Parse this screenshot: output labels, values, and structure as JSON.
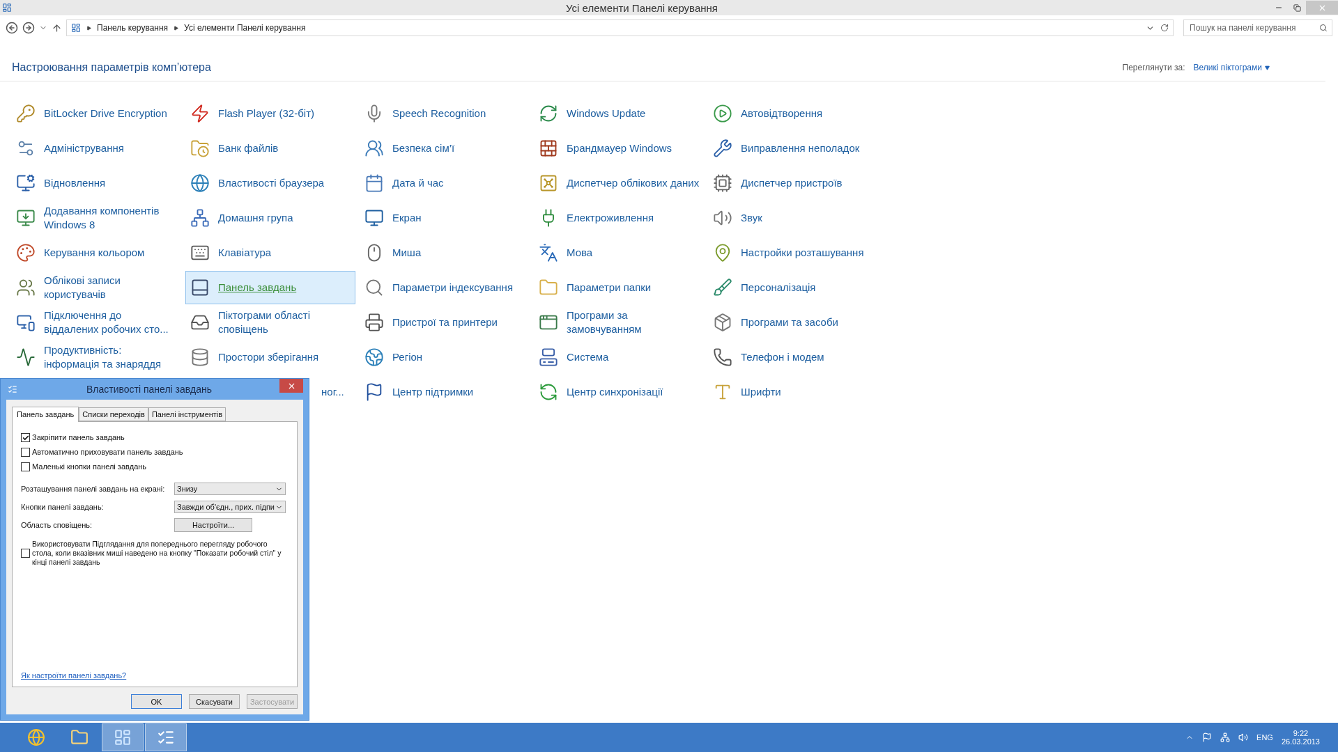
{
  "window": {
    "title": "Усі елементи Панелі керування"
  },
  "address_bar": {
    "breadcrumbs": [
      "Панель керування",
      "Усі елементи Панелі керування"
    ],
    "search": {
      "placeholder": "Пошук на панелі керування"
    }
  },
  "header": {
    "title": "Настроювання параметрів комп’ютера",
    "view_label": "Переглянути за:",
    "view_value": "Великі піктограми"
  },
  "columns": [
    {
      "items": [
        {
          "label": "BitLocker Drive Encryption",
          "selected": false
        },
        {
          "label": "Адміністрування",
          "selected": false
        },
        {
          "label": "Відновлення",
          "selected": false
        },
        {
          "label": "Додавання компонентів Windows 8",
          "selected": false
        },
        {
          "label": "Керування кольором",
          "selected": false
        },
        {
          "label": "Облікові записи користувачів",
          "selected": false
        },
        {
          "label": "Підключення до віддалених робочих сто...",
          "selected": false
        },
        {
          "label": "Продуктивність: інформація та знаряддя",
          "selected": false
        }
      ]
    },
    {
      "items": [
        {
          "label": "Flash Player (32-біт)",
          "selected": false
        },
        {
          "label": "Банк файлів",
          "selected": false
        },
        {
          "label": "Властивості браузера",
          "selected": false
        },
        {
          "label": "Домашня група",
          "selected": false
        },
        {
          "label": "Клавіатура",
          "selected": false
        },
        {
          "label": "Панель завдань",
          "selected": true
        },
        {
          "label": "Піктограми області сповіщень",
          "selected": false
        },
        {
          "label": "Простори зберігання",
          "selected": false
        },
        {
          "label": "ног...",
          "selected": false,
          "kind": "covered"
        }
      ]
    },
    {
      "items": [
        {
          "label": "Speech Recognition",
          "selected": false
        },
        {
          "label": "Безпека сім’ї",
          "selected": false
        },
        {
          "label": "Дата й час",
          "selected": false
        },
        {
          "label": "Екран",
          "selected": false
        },
        {
          "label": "Миша",
          "selected": false
        },
        {
          "label": "Параметри індексування",
          "selected": false
        },
        {
          "label": "Пристрої та принтери",
          "selected": false
        },
        {
          "label": "Регіон",
          "selected": false
        },
        {
          "label": "Центр підтримки",
          "selected": false
        }
      ]
    },
    {
      "items": [
        {
          "label": "Windows Update",
          "selected": false
        },
        {
          "label": "Брандмауер Windows",
          "selected": false
        },
        {
          "label": "Диспетчер облікових даних",
          "selected": false
        },
        {
          "label": "Електроживлення",
          "selected": false
        },
        {
          "label": "Мова",
          "selected": false
        },
        {
          "label": "Параметри папки",
          "selected": false
        },
        {
          "label": "Програми за замовчуванням",
          "selected": false
        },
        {
          "label": "Система",
          "selected": false
        },
        {
          "label": "Центр синхронізації",
          "selected": false
        }
      ]
    },
    {
      "items": [
        {
          "label": "Автовідтворення",
          "selected": false
        },
        {
          "label": "Виправлення неполадок",
          "selected": false
        },
        {
          "label": "Диспетчер пристроїв",
          "selected": false
        },
        {
          "label": "Звук",
          "selected": false
        },
        {
          "label": "Настройки розташування",
          "selected": false
        },
        {
          "label": "Персоналізація",
          "selected": false
        },
        {
          "label": "Програми та засоби",
          "selected": false
        },
        {
          "label": "Телефон і модем",
          "selected": false
        },
        {
          "label": "Шрифти",
          "selected": false
        }
      ]
    }
  ],
  "dialog": {
    "title": "Властивості панелі завдань",
    "tabs": [
      {
        "label": "Панель завдань",
        "selected": true
      },
      {
        "label": "Списки переходів",
        "selected": false
      },
      {
        "label": "Панелі інструментів",
        "selected": false
      }
    ],
    "checkboxes": [
      {
        "label": "Закріпити панель завдань",
        "checked": true
      },
      {
        "label": "Автоматично приховувати панель завдань",
        "checked": false
      },
      {
        "label": "Маленькі кнопки панелі завдань",
        "checked": false
      }
    ],
    "fields": [
      {
        "kind": "select",
        "label": "Розташування панелі завдань на екрані:",
        "value": "Знизу"
      },
      {
        "kind": "select",
        "label": "Кнопки панелі завдань:",
        "value": "Завжди об'єдн., прих. підпи"
      },
      {
        "kind": "button",
        "label": "Область сповіщень:",
        "value": "Настроїти..."
      }
    ],
    "preview": {
      "label": "Використовувати Підглядання для попереднього перегляду робочого стола, коли вказівник миші наведено на кнопку \"Показати робочий стіл\" у кінці панелі завдань",
      "checked": false
    },
    "help_link": "Як настроїти панелі завдань?",
    "buttons": [
      {
        "label": "OK",
        "disabled": false,
        "default": true
      },
      {
        "label": "Скасувати",
        "disabled": false,
        "default": false
      },
      {
        "label": "Застосувати",
        "disabled": true,
        "default": false
      }
    ]
  },
  "taskbar": {
    "apps": [
      {
        "selected": false
      },
      {
        "selected": false
      },
      {
        "selected": true
      },
      {
        "selected": true
      }
    ],
    "language": "ENG",
    "time": "9:22",
    "date": "26.03.2013"
  }
}
